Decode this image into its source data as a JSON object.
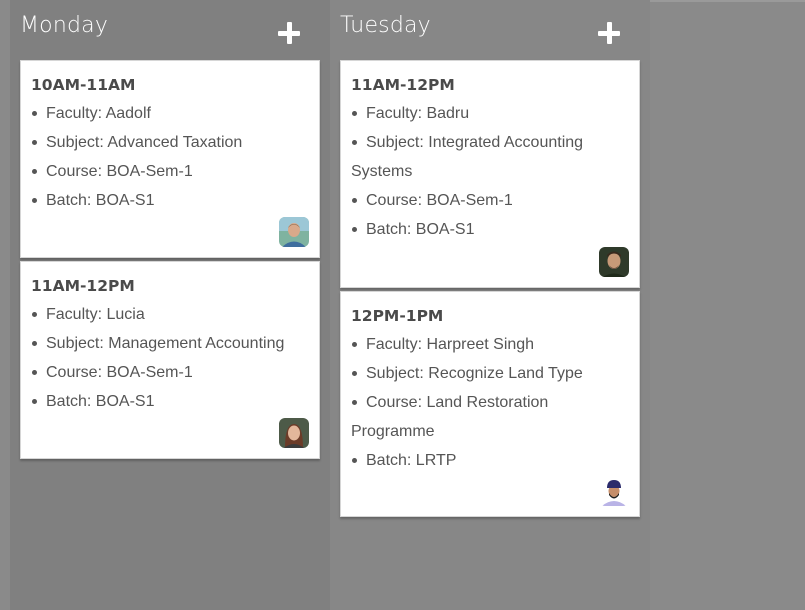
{
  "days": [
    {
      "name": "Monday",
      "slots": [
        {
          "time": "10AM-11AM",
          "faculty": "Faculty: Aadolf",
          "subject": "Subject: Advanced Taxation",
          "course": "Course: BOA-Sem-1",
          "batch": "Batch: BOA-S1"
        },
        {
          "time": "11AM-12PM",
          "faculty": "Faculty: Lucia",
          "subject": "Subject: Management Accounting",
          "course": "Course: BOA-Sem-1",
          "batch": "Batch: BOA-S1"
        }
      ]
    },
    {
      "name": "Tuesday",
      "slots": [
        {
          "time": "11AM-12PM",
          "faculty": "Faculty: Badru",
          "subject_line1": "Subject: Integrated Accounting",
          "subject_line2": "Systems",
          "course": "Course: BOA-Sem-1",
          "batch": "Batch: BOA-S1"
        },
        {
          "time": "12PM-1PM",
          "faculty": "Faculty: Harpreet Singh",
          "subject": "Subject: Recognize Land Type",
          "course_line1": "Course: Land Restoration",
          "course_line2": "Programme",
          "batch": "Batch: LRTP"
        }
      ]
    }
  ],
  "icons": {
    "add": "plus-icon",
    "avatar": "faculty-avatar"
  },
  "colors": {
    "background": "#8a8a8a",
    "column": "#808080",
    "card": "#ffffff",
    "text": "#555555"
  }
}
